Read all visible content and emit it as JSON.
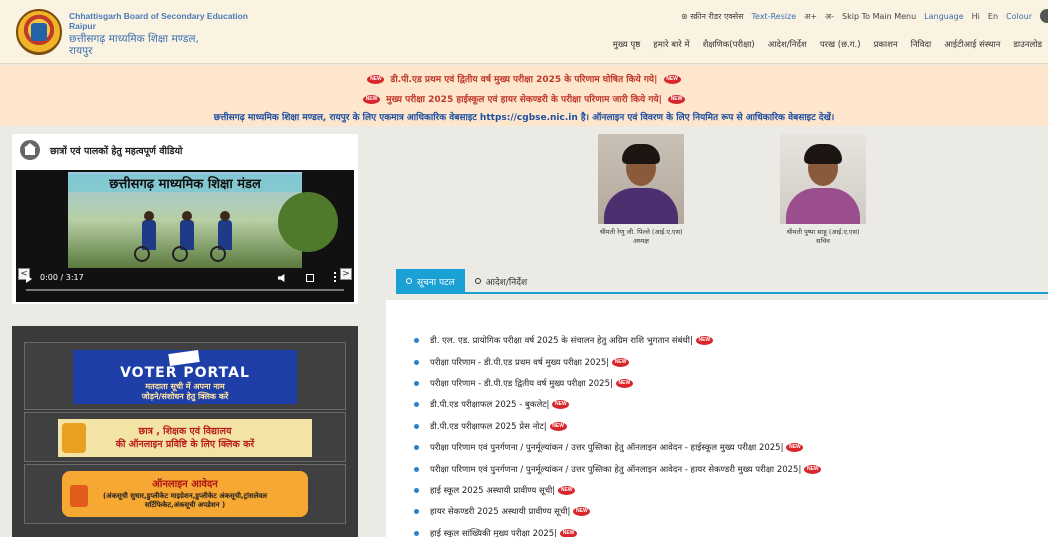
{
  "header": {
    "org_en_1": "Chhattisgarh Board of Secondary Education",
    "org_en_2": "Raipur",
    "org_hi_1": "छत्तीसगढ़ माध्यमिक शिक्षा मण्डल,",
    "org_hi_2": "रायपुर",
    "topbar": {
      "screen_reader": "स्क्रीन रीडर एक्सेस",
      "text_resize": "Text-Resize",
      "font_plus": "अ+",
      "font_minus": "अ-",
      "skip": "Skip To Main Menu",
      "language": "Language",
      "lang_hi": "Hi",
      "lang_en": "En",
      "colour": "Colour"
    },
    "nav": [
      "मुख्य पृष्ठ",
      "हमारे बारे में",
      "शैक्षणिक(परीक्षा)",
      "आदेश/निर्देश",
      "परख (छ.ग.)",
      "प्रकाशन",
      "निविदा",
      "आईटीआई संस्थान",
      "डाउनलोड"
    ]
  },
  "announcements": {
    "line1": "डी.पी.एड प्रथम एवं द्वितीय वर्ष मुख्य परीक्षा 2025 के परिणाम घोषित किये गये|",
    "line2": "मुख्य परीक्षा 2025 हाईस्कूल एवं हायर सेकण्डरी के परीक्षा परिणाम जारी किये गये|",
    "line3": "छत्तीसगढ़ माध्यमिक शिक्षा मण्डल, रायपुर के लिए एकमात्र आधिकारिक वेबसाइट https://cgbse.nic.in है। ऑनलाइन एवं विवरण के लिए नियमित रूप से आधिकारिक वेबसाइट देखें।",
    "new_label": "NEW"
  },
  "video_section": {
    "title": "छात्रों एवं पालकों हेतु महत्वपूर्ण वीडियो",
    "video_title": "छत्तीसगढ़ माध्यमिक शिक्षा मंडल",
    "time": "0:00 / 3:17",
    "progress": 0,
    "prev": "<",
    "next": ">"
  },
  "links": {
    "voter_1": "VOTER PORTAL",
    "voter_2": "मतदाता सूची में अपना नाम",
    "voter_3": "जोड़ने/संशोधन हेतु क्लिक करें",
    "student_1": "छात्र , शिक्षक एवं विद्यालय",
    "student_2": "की ऑनलाइन प्रविष्टि के लिए क्लिक करें",
    "online_1": "ऑनलाइन आवेदन",
    "online_2": "(अंकसूची सुधार,डुप्लीकेट माइग्रेशन,डुप्लीकेट अंकसूची,ट्रांसलेवल",
    "online_3": "सर्टिफिकेट,अंकसूची अपडेशन )"
  },
  "officials": [
    {
      "name": "श्रीमती रेणु जी. पिल्ले (आई.ए.एस)",
      "role": "अध्यक्ष"
    },
    {
      "name": "श्रीमती पुष्पा साहू (आई.ए.एस)",
      "role": "सचिव"
    }
  ],
  "tabs": [
    {
      "label": "सूचना पटल",
      "active": true
    },
    {
      "label": "आदेश/निर्देश",
      "active": false
    }
  ],
  "notices": [
    "डी. एल. एड. प्रायोगिक परीक्षा वर्ष 2025 के संचालन हेतु अग्रिम राशि भुगतान संबंधी|",
    "परीक्षा परिणाम - डी.पी.एड प्रथम वर्ष मुख्य परीक्षा 2025|",
    "परीक्षा परिणाम - डी.पी.एड द्वितीय वर्ष मुख्य परीक्षा 2025|",
    "डी.पी.एड परीक्षाफल 2025 - बुकलेट|",
    "डी.पी.एड परीक्षाफल 2025 प्रेस नोट|",
    "परीक्षा परिणाम एवं पुनर्गणना / पुनर्मूल्यांकन / उत्तर पुस्तिका हेतु ऑनलाइन आवेदन - हाईस्कूल मुख्य परीक्षा 2025|",
    "परीक्षा परिणाम एवं पुनर्गणना / पुनर्मूल्यांकन / उत्तर पुस्तिका हेतु ऑनलाइन आवेदन - हायर सेकण्डरी मुख्य परीक्षा 2025|",
    "हाई स्कूल 2025 अस्थायी प्रावीण्य सूची|",
    "हायर सेकण्डरी 2025 अस्थायी प्रावीण्य सूची|",
    "हाई स्कूल सांख्यिकी मुख्य परीक्षा 2025|"
  ],
  "colors": {
    "accent": "#1aa1d4",
    "announce_red": "#c0392b",
    "announce_blue": "#1f4fa0"
  }
}
